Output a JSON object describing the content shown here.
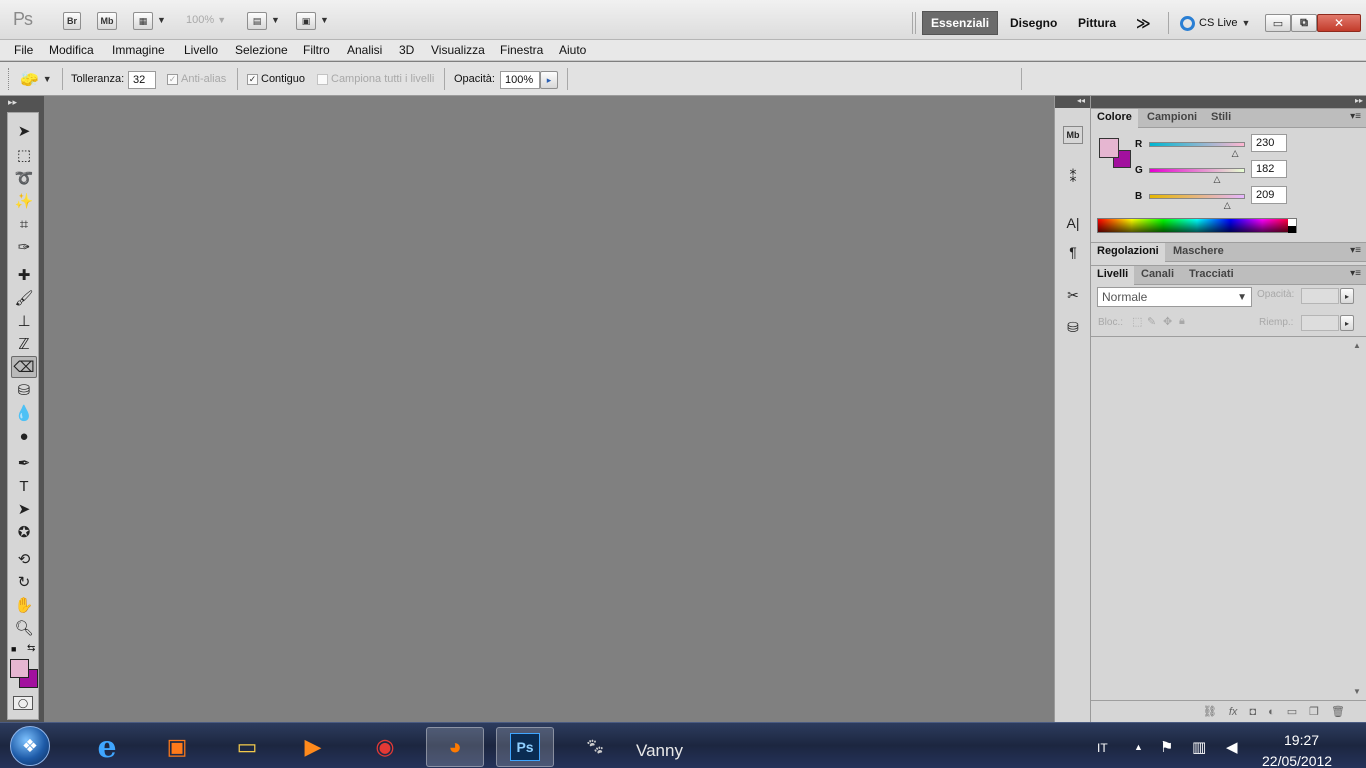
{
  "app": {
    "logo": "Ps",
    "bridge": "Br",
    "minibridge": "Mb",
    "zoom": "100%"
  },
  "workspaces": [
    "Essenziali",
    "Disegno",
    "Pittura"
  ],
  "workspace_more": "≫",
  "cslive": "CS Live",
  "window_controls": {
    "minimize": "▭",
    "restore": "⧉",
    "close": "✕"
  },
  "menu": [
    "File",
    "Modifica",
    "Immagine",
    "Livello",
    "Selezione",
    "Filtro",
    "Analisi",
    "3D",
    "Visualizza",
    "Finestra",
    "Aiuto"
  ],
  "options": {
    "tolerance_label": "Tolleranza:",
    "tolerance": "32",
    "antialias": "Anti-alias",
    "contiguous": "Contiguo",
    "sample_all": "Campiona tutti i livelli",
    "opacity_label": "Opacità:",
    "opacity": "100%"
  },
  "color_panel": {
    "tabs": [
      "Colore",
      "Campioni",
      "Stili"
    ],
    "r_label": "R",
    "g_label": "G",
    "b_label": "B",
    "r": "230",
    "g": "182",
    "b": "209",
    "r_fraction": 0.902,
    "g_fraction": 0.714,
    "b_fraction": 0.82,
    "foreground": "#e6b6d1",
    "background": "#a2109e"
  },
  "adjust_panel": {
    "tabs": [
      "Regolazioni",
      "Maschere"
    ]
  },
  "layers_panel": {
    "tabs": [
      "Livelli",
      "Canali",
      "Tracciati"
    ],
    "blend": "Normale",
    "opacity_label": "Opacità:",
    "lock_label": "Bloc.:",
    "fill_label": "Riemp.:"
  },
  "taskbar": {
    "user": "Vanny",
    "lang": "IT",
    "time": "19:27",
    "date": "22/05/2012"
  },
  "colors": {
    "canvas": "#808080",
    "workspace_active": "#6b6b6b"
  }
}
